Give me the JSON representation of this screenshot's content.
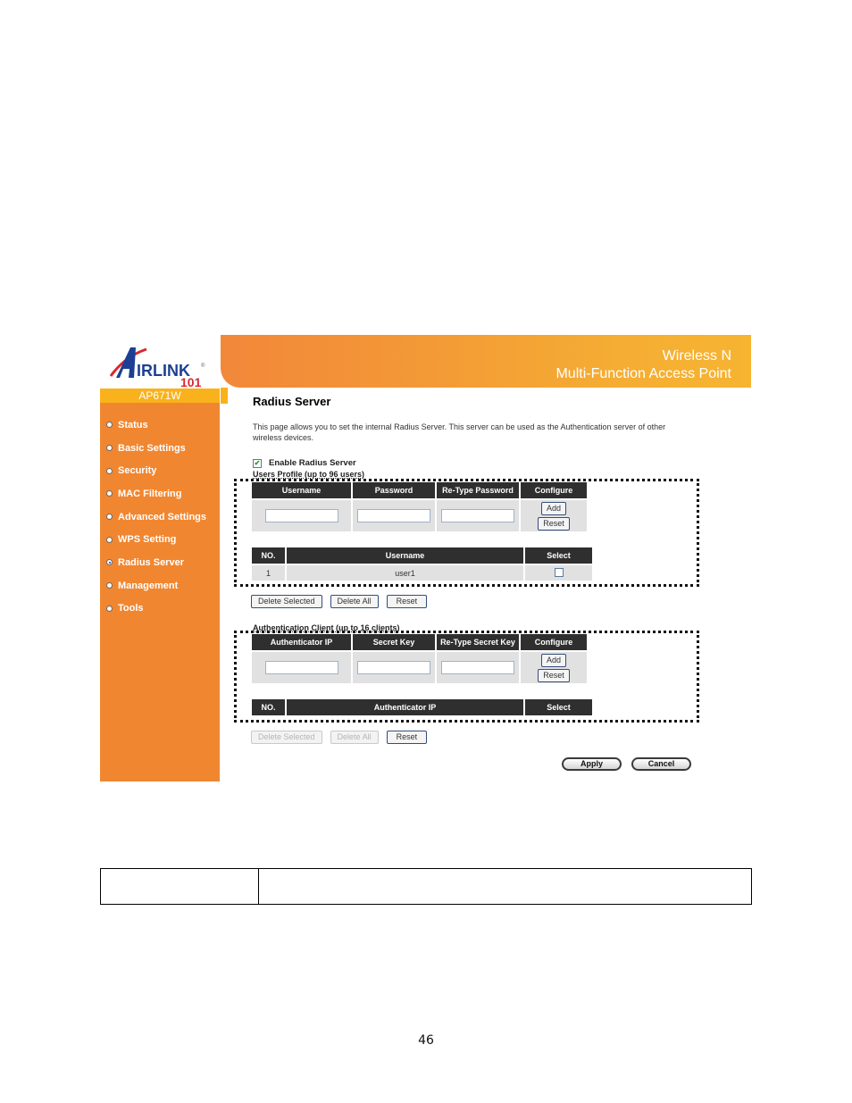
{
  "brand": {
    "logo_text": "AIRLINK",
    "logo_suffix": "101",
    "model": "AP671W"
  },
  "header": {
    "line1": "Wireless N",
    "line2": "Multi-Function Access Point"
  },
  "sidebar": {
    "items": [
      {
        "label": "Status",
        "active": false
      },
      {
        "label": "Basic Settings",
        "active": false
      },
      {
        "label": "Security",
        "active": false
      },
      {
        "label": "MAC Filtering",
        "active": false
      },
      {
        "label": "Advanced Settings",
        "active": false
      },
      {
        "label": "WPS Setting",
        "active": false
      },
      {
        "label": "Radius Server",
        "active": true
      },
      {
        "label": "Management",
        "active": false
      },
      {
        "label": "Tools",
        "active": false
      }
    ]
  },
  "main": {
    "title": "Radius Server",
    "description": "This page allows you to set the internal Radius Server. This server can be used as the Authentication server of other wireless devices.",
    "enable_label": "Enable Radius Server",
    "enable_checked": true,
    "users": {
      "section_label": "Users Profile (up to 96 users)",
      "form_headers": [
        "Username",
        "Password",
        "Re-Type Password",
        "Configure"
      ],
      "form_values": {
        "username": "",
        "password": "",
        "retype_password": ""
      },
      "add_label": "Add",
      "reset_label": "Reset",
      "list_headers": [
        "NO.",
        "Username",
        "Select"
      ],
      "rows": [
        {
          "no": "1",
          "username": "user1",
          "selected": false
        }
      ],
      "buttons": {
        "delete_selected": "Delete Selected",
        "delete_all": "Delete All",
        "reset": "Reset"
      }
    },
    "clients": {
      "section_label": "Authentication Client (up to 16 clients)",
      "form_headers": [
        "Authenticator IP",
        "Secret Key",
        "Re-Type Secret Key",
        "Configure"
      ],
      "form_values": {
        "ip": "",
        "secret": "",
        "retype_secret": ""
      },
      "add_label": "Add",
      "reset_label": "Reset",
      "list_headers": [
        "NO.",
        "Authenticator IP",
        "Select"
      ],
      "rows": [],
      "buttons": {
        "delete_selected": "Delete Selected",
        "delete_all": "Delete All",
        "reset": "Reset"
      }
    },
    "apply_label": "Apply",
    "cancel_label": "Cancel"
  },
  "doc": {
    "table_cells": [
      "",
      ""
    ],
    "page_number": "46"
  }
}
